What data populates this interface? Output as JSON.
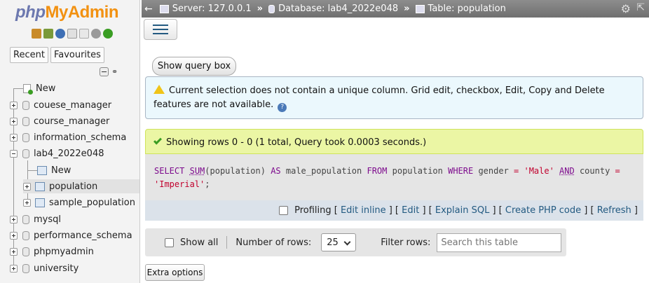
{
  "nav": {
    "logo_php": "php",
    "logo_myadmin": "MyAdmin",
    "tab_recent": "Recent",
    "tab_favourites": "Favourites",
    "tree": [
      {
        "label": "New",
        "kind": "new"
      },
      {
        "label": "couese_manager",
        "kind": "db"
      },
      {
        "label": "course_manager",
        "kind": "db"
      },
      {
        "label": "information_schema",
        "kind": "db"
      },
      {
        "label": "lab4_2022e048",
        "kind": "db-open"
      },
      {
        "label": "New",
        "kind": "child-new"
      },
      {
        "label": "population",
        "kind": "child-table"
      },
      {
        "label": "sample_population",
        "kind": "child-table"
      },
      {
        "label": "mysql",
        "kind": "db"
      },
      {
        "label": "performance_schema",
        "kind": "db"
      },
      {
        "label": "phpmyadmin",
        "kind": "db"
      },
      {
        "label": "university",
        "kind": "db"
      }
    ]
  },
  "breadcrumb": {
    "server": "Server: 127.0.0.1",
    "database": "Database: lab4_2022e048",
    "table": "Table: population"
  },
  "show_query_box": "Show query box",
  "notice": {
    "text": "Current selection does not contain a unique column. Grid edit, checkbox, Edit, Copy and Delete features are not available."
  },
  "success": {
    "text": "Showing rows 0 - 0 (1 total, Query took 0.0003 seconds.)"
  },
  "sql": {
    "t1": "SELECT",
    "t2": "SUM",
    "t3": "(population) ",
    "t4": "AS",
    "t5": " male_population ",
    "t6": "FROM",
    "t7": " population ",
    "t8": "WHERE",
    "t9": " gender ",
    "t10": "=",
    "t11": " 'Male' ",
    "t12": "AND",
    "t13": " county ",
    "t14": "=",
    "t15": "'Imperial'",
    "t16": ";"
  },
  "sql_links": {
    "profiling": "Profiling",
    "edit_inline": "Edit inline",
    "edit": "Edit",
    "explain": "Explain SQL",
    "create_php": "Create PHP code",
    "refresh": "Refresh"
  },
  "navbar": {
    "show_all": "Show all",
    "rows_label": "Number of rows:",
    "rows_value": "25",
    "filter_label": "Filter rows:",
    "filter_placeholder": "Search this table"
  },
  "extra_options": "Extra options"
}
